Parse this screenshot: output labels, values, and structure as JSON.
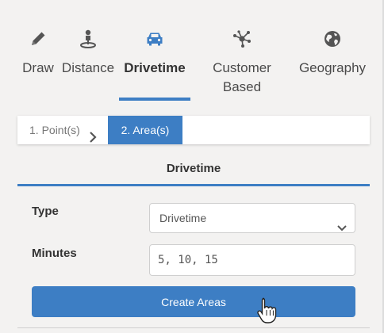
{
  "tabs": [
    {
      "label": "Draw",
      "icon": "pencil-icon"
    },
    {
      "label": "Distance",
      "icon": "person-pin-icon"
    },
    {
      "label": "Drivetime",
      "icon": "car-icon",
      "active": true
    },
    {
      "label": "Customer\nBased",
      "icon": "network-icon"
    },
    {
      "label": "Geography",
      "icon": "globe-icon"
    }
  ],
  "stepper": {
    "step1": "1. Point(s)",
    "step2": "2. Area(s)"
  },
  "section": {
    "title": "Drivetime"
  },
  "form": {
    "type_label": "Type",
    "type_value": "Drivetime",
    "minutes_label": "Minutes",
    "minutes_value": "5, 10, 15"
  },
  "actions": {
    "create_label": "Create Areas"
  },
  "colors": {
    "accent": "#3d7ec4",
    "icon": "#555555",
    "background": "#f3f2f1"
  }
}
